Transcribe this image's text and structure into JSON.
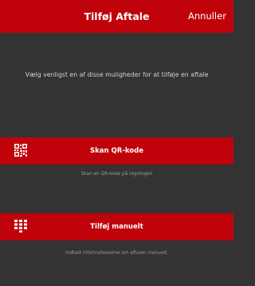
{
  "header": {
    "title": "Tilføj Aftale",
    "cancel_label": "Annuller"
  },
  "intro_text": "Vælg venligst en af disse muligheder for at tilføje en aftale",
  "options": [
    {
      "icon": "qr-code-icon",
      "label": "Skan QR-kode",
      "caption": "Skan en QR-kode på regningen"
    },
    {
      "icon": "keypad-icon",
      "label": "Tilføj manuelt",
      "caption": "Indtast informationerne om aftalen manuelt."
    }
  ],
  "colors": {
    "accent": "#c0030a",
    "background": "#333333",
    "text_light": "#d3d3d3",
    "text_muted": "#9a9a9a"
  }
}
